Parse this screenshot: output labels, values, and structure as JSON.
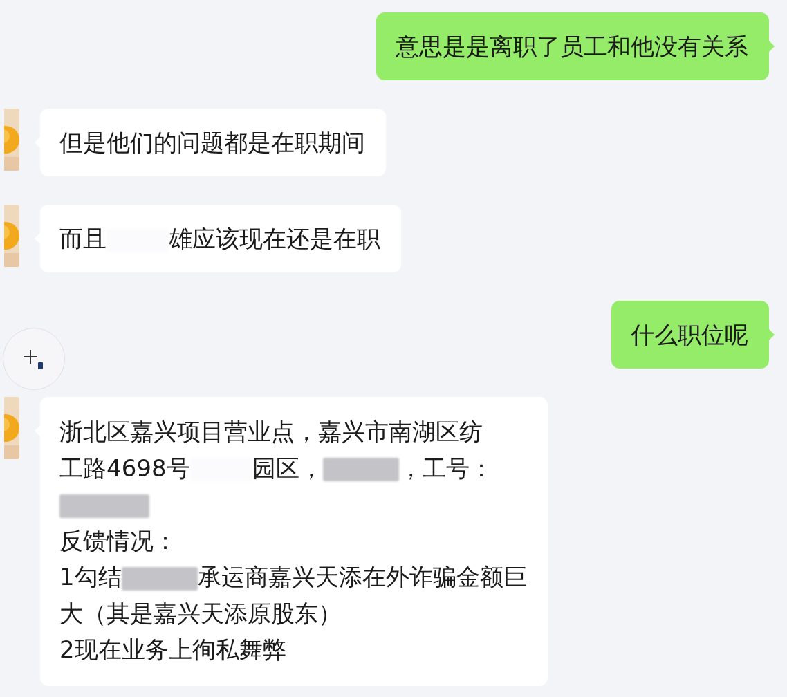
{
  "messages": [
    {
      "kind": "outgoing",
      "lines": [
        [
          {
            "kind": "text",
            "text": "意思是是离职了员工和他没有关系"
          }
        ]
      ]
    },
    {
      "kind": "incoming",
      "lines": [
        [
          {
            "kind": "text",
            "text": "但是他们的问题都是在职期间"
          }
        ]
      ]
    },
    {
      "kind": "incoming",
      "lines": [
        [
          {
            "kind": "text",
            "text": "而且"
          },
          {
            "kind": "erased"
          },
          {
            "kind": "text",
            "text": "雄应该现在还是在职"
          }
        ]
      ]
    },
    {
      "kind": "outgoing",
      "lines": [
        [
          {
            "kind": "text",
            "text": "什么职位呢"
          }
        ]
      ]
    },
    {
      "kind": "incoming",
      "lines": [
        [
          {
            "kind": "text",
            "text": "浙北区嘉兴项目营业点，嘉兴市南湖区纺"
          }
        ],
        [
          {
            "kind": "text",
            "text": "工路4698号"
          },
          {
            "kind": "erased"
          },
          {
            "kind": "text",
            "text": "园区，"
          },
          {
            "kind": "redacted"
          },
          {
            "kind": "text",
            "text": "，工号："
          }
        ],
        [
          {
            "kind": "redacted"
          }
        ],
        [
          {
            "kind": "text",
            "text": "反馈情况："
          }
        ],
        [
          {
            "kind": "text",
            "text": "1勾结"
          },
          {
            "kind": "redacted"
          },
          {
            "kind": "text",
            "text": "承运商嘉兴天添在外诈骗金额巨"
          }
        ],
        [
          {
            "kind": "text",
            "text": "大（其是嘉兴天添原股东）"
          }
        ],
        [
          {
            "kind": "text",
            "text": "2现在业务上徇私舞弊"
          }
        ]
      ]
    }
  ]
}
